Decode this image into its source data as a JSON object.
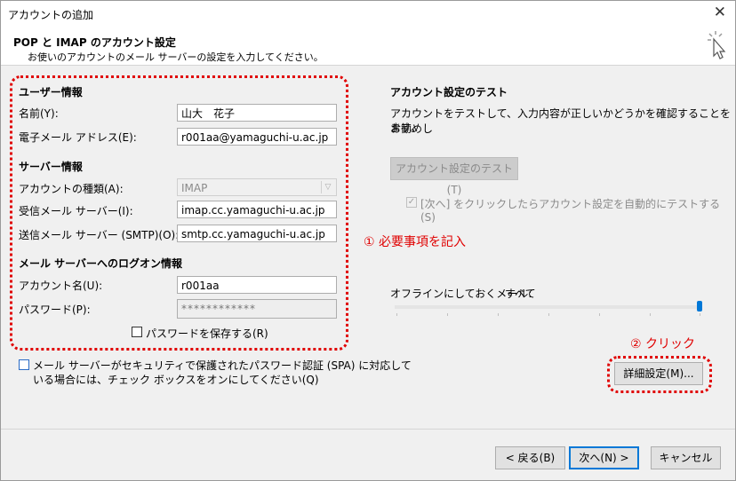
{
  "window": {
    "title": "アカウントの追加",
    "close_glyph": "✕"
  },
  "header": {
    "title": "POP と IMAP のアカウント設定",
    "subtitle": "お使いのアカウントのメール サーバーの設定を入力してください。"
  },
  "user_info": {
    "heading": "ユーザー情報",
    "name_label": "名前(Y):",
    "name_value": "山大　花子",
    "email_label": "電子メール アドレス(E):",
    "email_value": "r001aa@yamaguchi-u.ac.jp"
  },
  "server_info": {
    "heading": "サーバー情報",
    "account_type_label": "アカウントの種類(A):",
    "account_type_value": "IMAP",
    "incoming_label": "受信メール サーバー(I):",
    "incoming_value": "imap.cc.yamaguchi-u.ac.jp",
    "outgoing_label": "送信メール サーバー (SMTP)(O):",
    "outgoing_value": "smtp.cc.yamaguchi-u.ac.jp"
  },
  "logon_info": {
    "heading": "メール サーバーへのログオン情報",
    "account_name_label": "アカウント名(U):",
    "account_name_value": "r001aa",
    "password_label": "パスワード(P):",
    "password_value": "************",
    "save_password_label": "パスワードを保存する(R)"
  },
  "spa": {
    "line1": "メール サーバーがセキュリティで保護されたパスワード認証 (SPA) に対応して",
    "line2": "いる場合には、チェック ボックスをオンにしてください(Q)"
  },
  "test": {
    "heading": "アカウント設定のテスト",
    "desc_line1": "アカウントをテストして、入力内容が正しいかどうかを確認することをお勧めし",
    "desc_line2": "ます。",
    "button": "アカウント設定のテスト(T)",
    "auto_test_label": "[次へ] をクリックしたらアカウント設定を自動的にテストする(S)"
  },
  "offline": {
    "label": "オフラインにしておくメール:",
    "value": "すべて",
    "level_percent": 100
  },
  "annotations": {
    "step1": "① 必要事項を記入",
    "step2": "② クリック"
  },
  "buttons": {
    "more_settings": "詳細設定(M)...",
    "back": "< 戻る(B)",
    "next": "次へ(N) >",
    "cancel": "キャンセル"
  },
  "colors": {
    "annotation_red": "#e00000",
    "accent_blue": "#0078d7"
  }
}
